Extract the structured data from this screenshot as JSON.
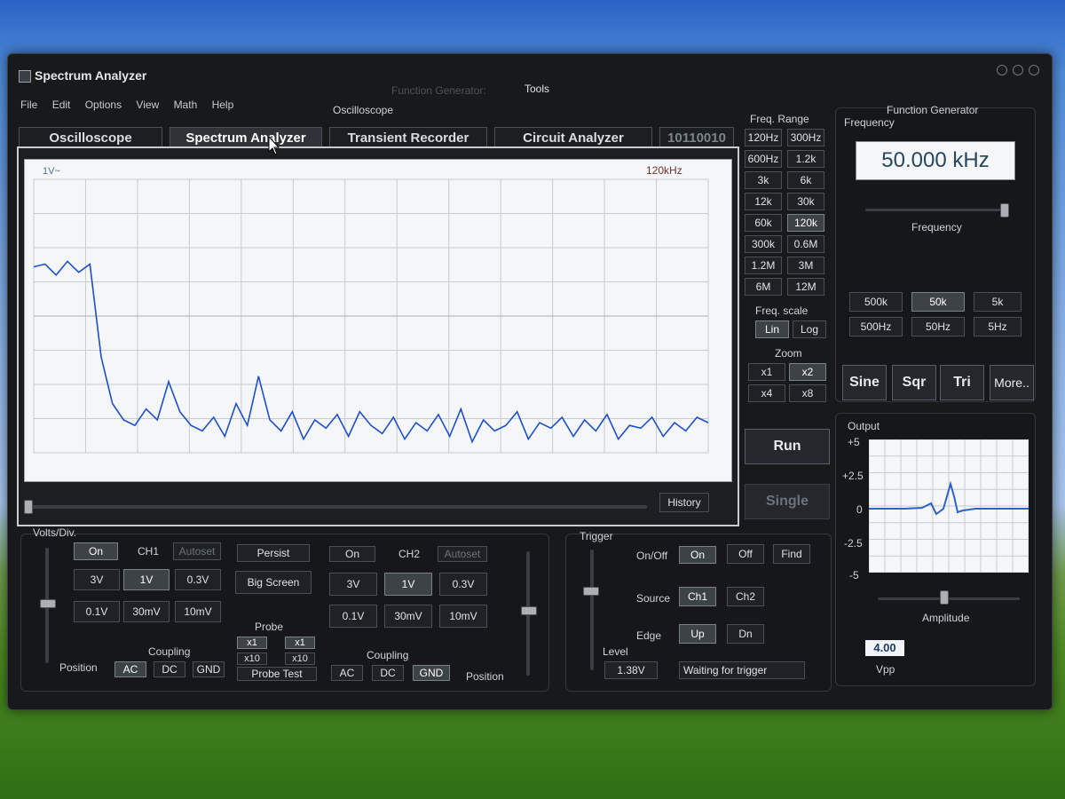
{
  "window": {
    "title": "Spectrum Analyzer"
  },
  "menu": [
    "File",
    "Edit",
    "Options",
    "View",
    "Math",
    "Help"
  ],
  "top_labels": {
    "function_generator": "Function Generator:",
    "tools": "Tools",
    "oscilloscope": "Oscilloscope"
  },
  "tabs": [
    "Oscilloscope",
    "Spectrum Analyzer",
    "Transient Recorder",
    "Circuit Analyzer",
    "10110010"
  ],
  "display": {
    "ylabel": "1V~",
    "freq_label": "120kHz",
    "history": "History"
  },
  "chart_data": {
    "type": "line",
    "xlim": [
      0,
      120
    ],
    "ylim": [
      0,
      1
    ],
    "x": [
      0,
      2,
      4,
      6,
      8,
      10,
      12,
      14,
      16,
      18,
      20,
      22,
      24,
      26,
      28,
      30,
      32,
      34,
      36,
      38,
      40,
      42,
      44,
      46,
      48,
      50,
      52,
      54,
      56,
      58,
      60,
      62,
      64,
      66,
      68,
      70,
      72,
      74,
      76,
      78,
      80,
      82,
      84,
      86,
      88,
      90,
      92,
      94,
      96,
      98,
      100,
      102,
      104,
      106,
      108,
      110,
      112,
      114,
      116,
      118,
      120
    ],
    "series": [
      {
        "values": [
          0.68,
          0.69,
          0.65,
          0.7,
          0.66,
          0.69,
          0.35,
          0.18,
          0.12,
          0.1,
          0.16,
          0.12,
          0.26,
          0.15,
          0.1,
          0.08,
          0.13,
          0.06,
          0.18,
          0.1,
          0.28,
          0.12,
          0.08,
          0.15,
          0.05,
          0.12,
          0.09,
          0.14,
          0.06,
          0.15,
          0.1,
          0.07,
          0.13,
          0.05,
          0.11,
          0.08,
          0.14,
          0.06,
          0.16,
          0.04,
          0.12,
          0.08,
          0.1,
          0.15,
          0.05,
          0.11,
          0.09,
          0.13,
          0.06,
          0.12,
          0.08,
          0.14,
          0.05,
          0.1,
          0.09,
          0.13,
          0.06,
          0.11,
          0.08,
          0.13,
          0.11
        ]
      }
    ]
  },
  "freq_range": {
    "title": "Freq. Range",
    "buttons": [
      "120Hz",
      "300Hz",
      "600Hz",
      "1.2k",
      "3k",
      "6k",
      "12k",
      "30k",
      "60k",
      "120k",
      "300k",
      "0.6M",
      "1.2M",
      "3M",
      "6M",
      "12M"
    ],
    "selected": "120k"
  },
  "freq_scale": {
    "title": "Freq. scale",
    "lin": "Lin",
    "log": "Log"
  },
  "zoom": {
    "title": "Zoom",
    "buttons": [
      "x1",
      "x2",
      "x4",
      "x8"
    ]
  },
  "run": "Run",
  "single": "Single",
  "fg": {
    "title": "Function Generator",
    "freq_label": "Frequency",
    "freq_value": "50.000 kHz",
    "slider_label": "Frequency",
    "range_buttons": [
      "500k",
      "50k",
      "5k",
      "500Hz",
      "50Hz",
      "5Hz"
    ],
    "wave_buttons": [
      "Sine",
      "Sqr",
      "Tri",
      "More.."
    ],
    "output_label": "Output",
    "output_ticks": [
      "+5",
      "+2.5",
      "0",
      "-2.5",
      "-5"
    ],
    "amplitude_label": "Amplitude",
    "vpp_value": "4.00",
    "vpp_label": "Vpp"
  },
  "ch1": {
    "volts_div": "Volts/Div.",
    "on": "On",
    "name": "CH1",
    "autoset": "Autoset",
    "volts": [
      "3V",
      "1V",
      "0.3V",
      "0.1V",
      "30mV",
      "10mV"
    ],
    "coupling_label": "Coupling",
    "position_label": "Position",
    "coupling": [
      "AC",
      "DC",
      "GND"
    ]
  },
  "middle": {
    "persist": "Persist",
    "big_screen": "Big Screen",
    "probe": "Probe",
    "x1": "x1",
    "x10": "x10",
    "probe_test": "Probe Test"
  },
  "ch2": {
    "on": "On",
    "name": "CH2",
    "autoset": "Autoset",
    "volts": [
      "3V",
      "1V",
      "0.3V",
      "0.1V",
      "30mV",
      "10mV"
    ],
    "coupling_label": "Coupling",
    "position_label": "Position",
    "coupling": [
      "AC",
      "DC",
      "GND"
    ]
  },
  "trigger": {
    "title": "Trigger",
    "onoff_label": "On/Off",
    "on": "On",
    "off": "Off",
    "find": "Find",
    "source_label": "Source",
    "ch1": "Ch1",
    "ch2": "Ch2",
    "edge_label": "Edge",
    "up": "Up",
    "dn": "Dn",
    "level_label": "Level",
    "level_value": "1.38V",
    "status": "Waiting for trigger"
  }
}
